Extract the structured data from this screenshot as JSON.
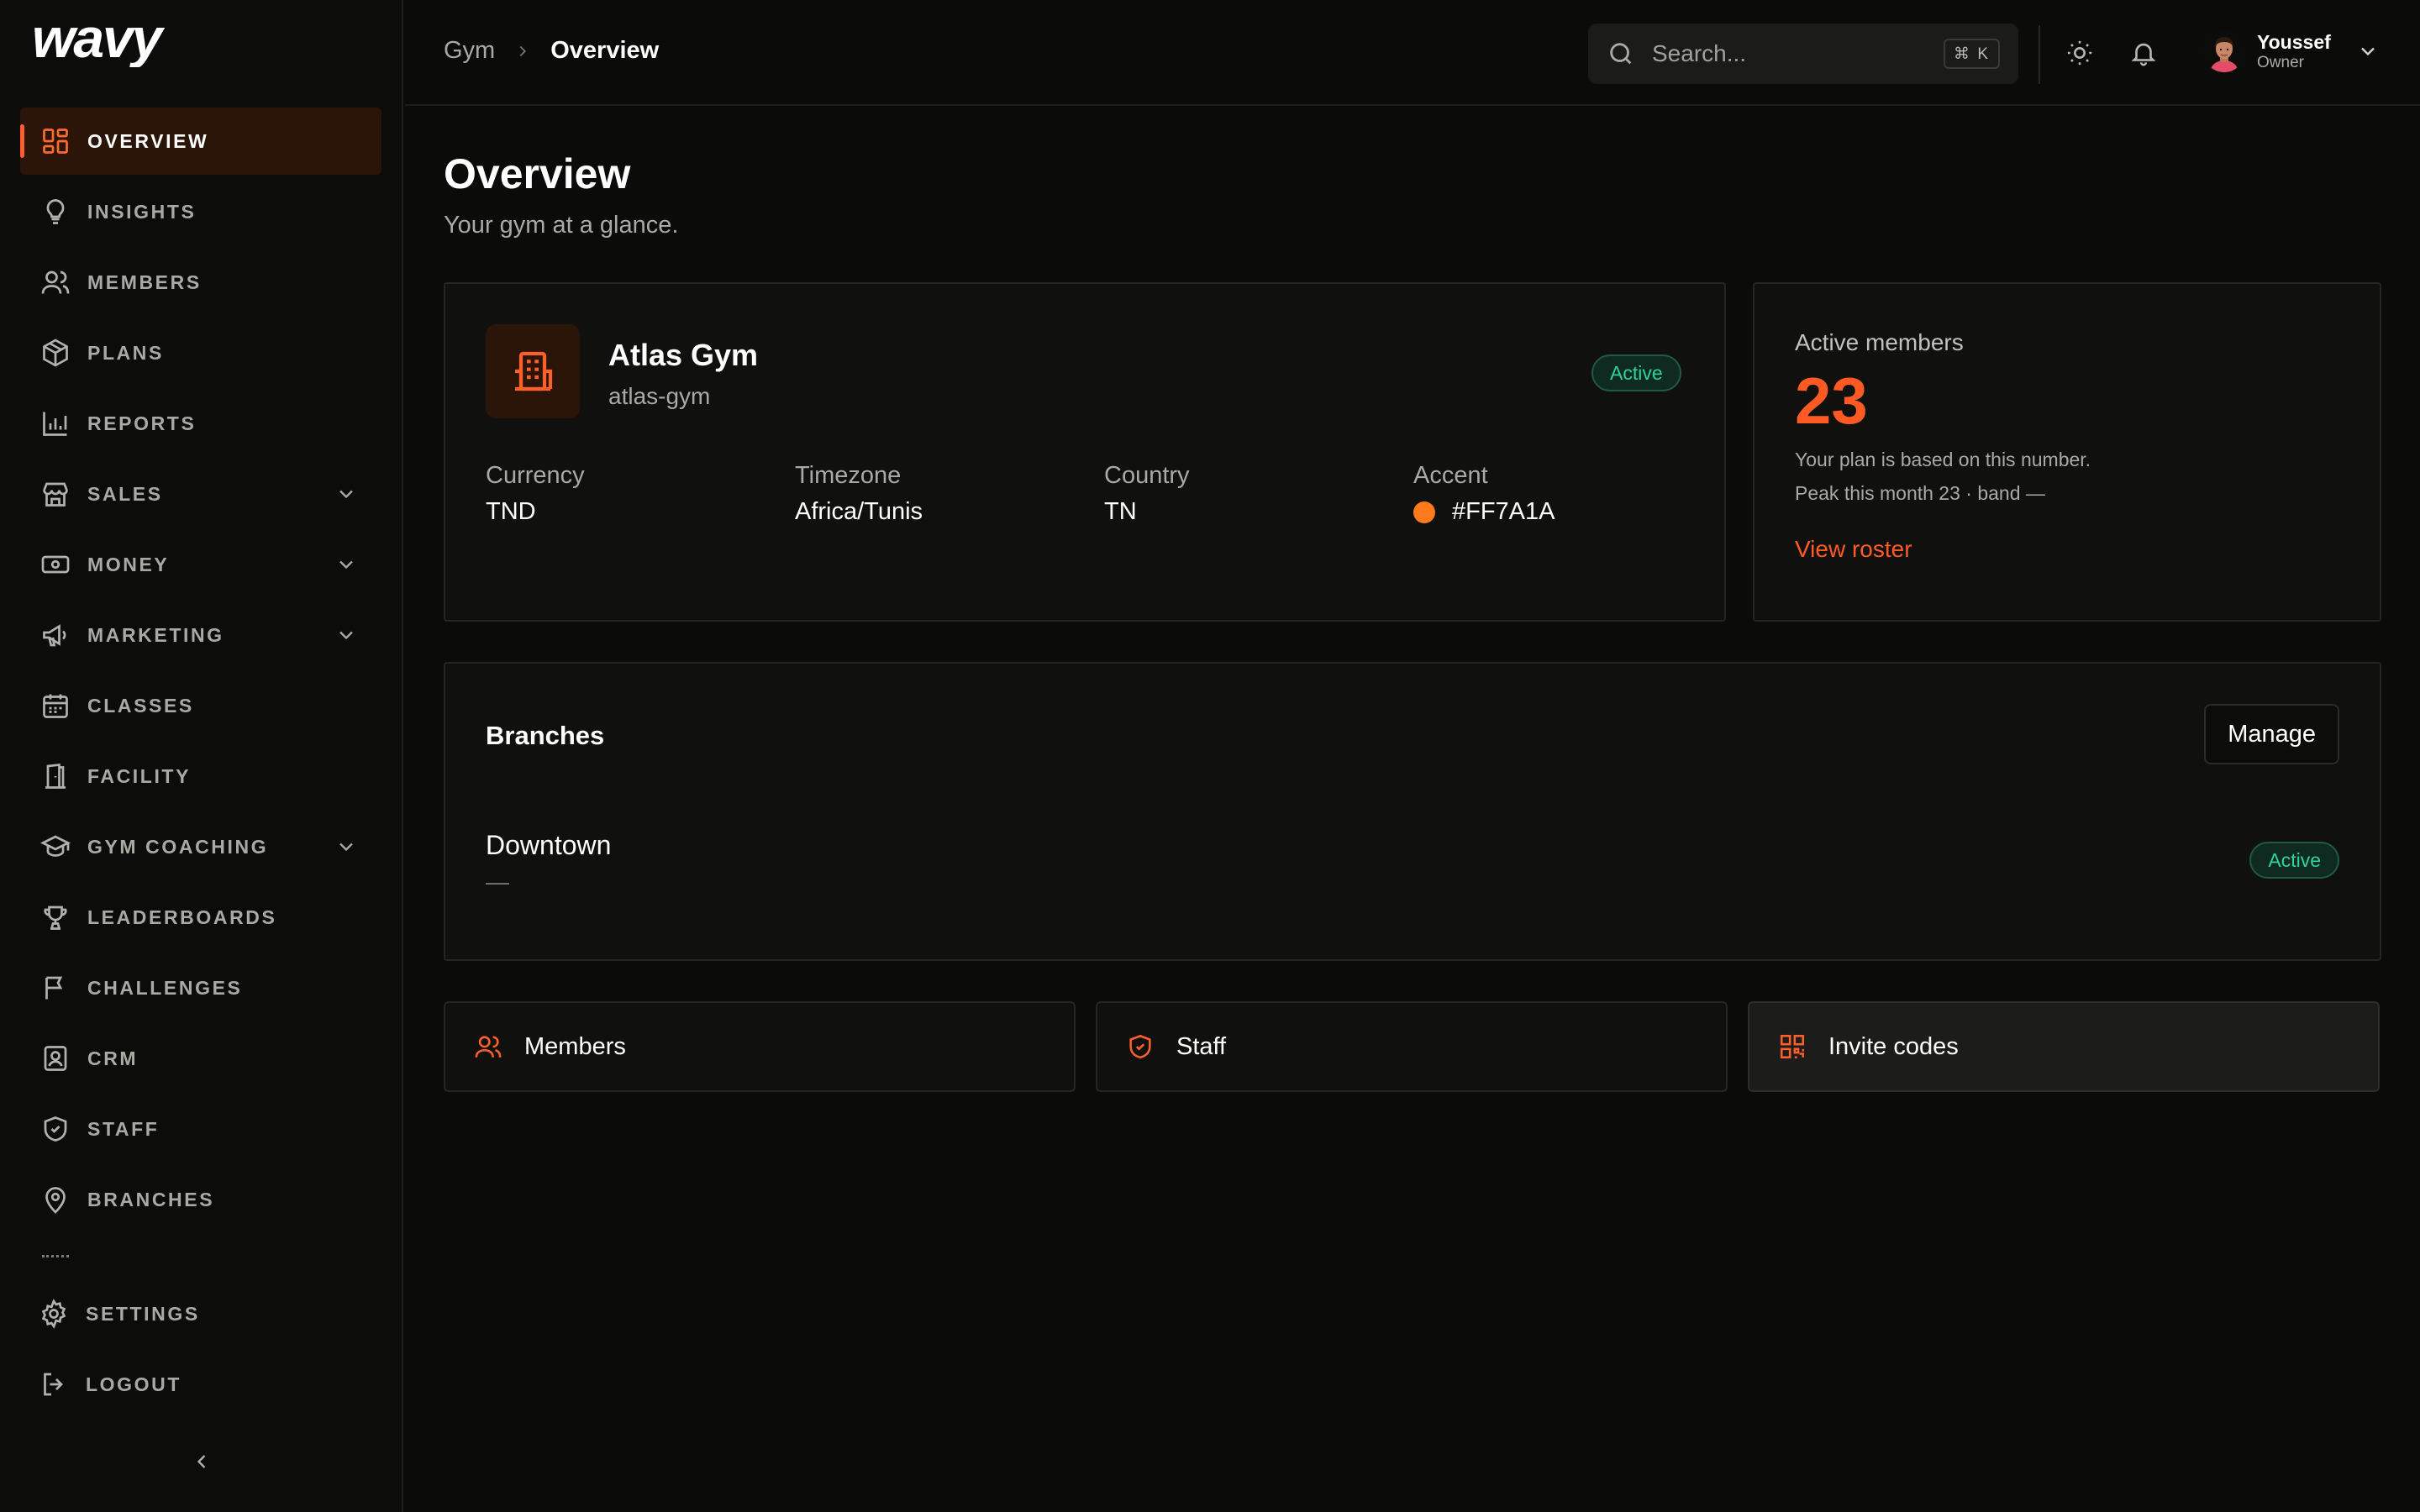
{
  "app": {
    "logo_text": "wavy"
  },
  "sidebar": {
    "items": [
      {
        "label": "Overview",
        "icon": "grid-icon"
      },
      {
        "label": "Insights",
        "icon": "lightbulb-icon"
      },
      {
        "label": "Members",
        "icon": "users-icon"
      },
      {
        "label": "Plans",
        "icon": "box-icon"
      },
      {
        "label": "Reports",
        "icon": "bar-chart-icon"
      },
      {
        "label": "Sales",
        "icon": "store-icon"
      },
      {
        "label": "Money",
        "icon": "banknote-icon"
      },
      {
        "label": "Marketing",
        "icon": "megaphone-icon"
      },
      {
        "label": "Classes",
        "icon": "calendar-icon"
      },
      {
        "label": "Facility",
        "icon": "door-icon"
      },
      {
        "label": "Gym Coaching",
        "icon": "graduation-cap-icon"
      },
      {
        "label": "Leaderboards",
        "icon": "trophy-icon"
      },
      {
        "label": "Challenges",
        "icon": "flag-icon"
      },
      {
        "label": "CRM",
        "icon": "contact-icon"
      },
      {
        "label": "Staff",
        "icon": "shield-check-icon"
      },
      {
        "label": "Branches",
        "icon": "map-pin-icon"
      }
    ],
    "bottom": [
      {
        "label": "Settings",
        "icon": "gear-icon"
      },
      {
        "label": "Logout",
        "icon": "logout-icon"
      }
    ]
  },
  "header": {
    "breadcrumb_root": "Gym",
    "breadcrumb_current": "Overview",
    "search_placeholder": "Search...",
    "search_shortcut": "⌘ K",
    "user_name": "Youssef",
    "user_role": "Owner"
  },
  "main": {
    "title": "Overview",
    "subtitle": "Your gym at a glance.",
    "gym": {
      "name": "Atlas Gym",
      "slug": "atlas-gym",
      "status": "Active",
      "fields": [
        {
          "label": "Currency",
          "value": "TND"
        },
        {
          "label": "Timezone",
          "value": "Africa/Tunis"
        },
        {
          "label": "Country",
          "value": "TN"
        },
        {
          "label": "Accent",
          "value": "#FF7A1A"
        }
      ],
      "accent_color": "#FF7A1A"
    },
    "active_members": {
      "label": "Active members",
      "count": "23",
      "note": "Your plan is based on this number.",
      "peak": "Peak this month 23 · band —",
      "link": "View roster"
    },
    "branches": {
      "title": "Branches",
      "manage_label": "Manage",
      "items": [
        {
          "name": "Downtown",
          "sub": "—",
          "status": "Active"
        }
      ]
    },
    "quick_links": [
      {
        "label": "Members",
        "icon": "users-icon"
      },
      {
        "label": "Staff",
        "icon": "shield-check-icon"
      },
      {
        "label": "Invite codes",
        "icon": "qr-code-icon"
      }
    ]
  },
  "colors": {
    "brand_accent": "#FF5A24",
    "status_active": "#2FD39A",
    "background": "#0B0C0A"
  }
}
